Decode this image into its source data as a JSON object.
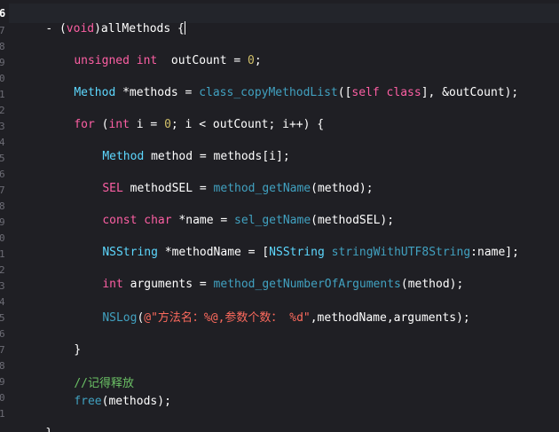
{
  "editor": {
    "line_numbers": [
      "6",
      "7",
      "8",
      "9",
      "0",
      "1",
      "2",
      "3",
      "4",
      "5",
      "6",
      "7",
      "8",
      "9",
      "0",
      "1",
      "2",
      "3",
      "4",
      "5",
      "6",
      "7",
      "8",
      "9",
      "0",
      "1"
    ],
    "current_line_number": "6",
    "colors": {
      "background": "#1f1f24",
      "keyword": "#fc5fa3",
      "type": "#5dd8ff",
      "function": "#41a1c0",
      "string": "#fc6a5d",
      "number": "#d0bf69",
      "comment": "#6bc165",
      "plain": "#ffffff",
      "line_number": "#6c6c75"
    },
    "code": {
      "l1": [
        "- (",
        "void",
        ")allMethods {"
      ],
      "l2": [
        "unsigned",
        " ",
        "int",
        "  outCount = ",
        "0",
        ";"
      ],
      "l3": [
        "Method",
        " *methods = ",
        "class_copyMethodList",
        "([",
        "self",
        " ",
        "class",
        "], &outCount);"
      ],
      "l4": [
        "for",
        " (",
        "int",
        " i = ",
        "0",
        "; i < outCount; i++) {"
      ],
      "l5": [
        "Method",
        " method = methods[i];"
      ],
      "l6": [
        "SEL",
        " methodSEL = ",
        "method_getName",
        "(method);"
      ],
      "l7": [
        "const",
        " ",
        "char",
        " *name = ",
        "sel_getName",
        "(methodSEL);"
      ],
      "l8": [
        "NSString",
        " *methodName = [",
        "NSString",
        " ",
        "stringWithUTF8String",
        ":name];"
      ],
      "l9": [
        "int",
        " arguments = ",
        "method_getNumberOfArguments",
        "(method);"
      ],
      "l10": [
        "NSLog",
        "(",
        "@\"方法名：%@,参数个数： %d\"",
        ",methodName,arguments);"
      ],
      "l11": [
        "}"
      ],
      "l12": [
        "//记得释放"
      ],
      "l13": [
        "free",
        "(methods);"
      ],
      "l14": [
        "}"
      ]
    }
  }
}
